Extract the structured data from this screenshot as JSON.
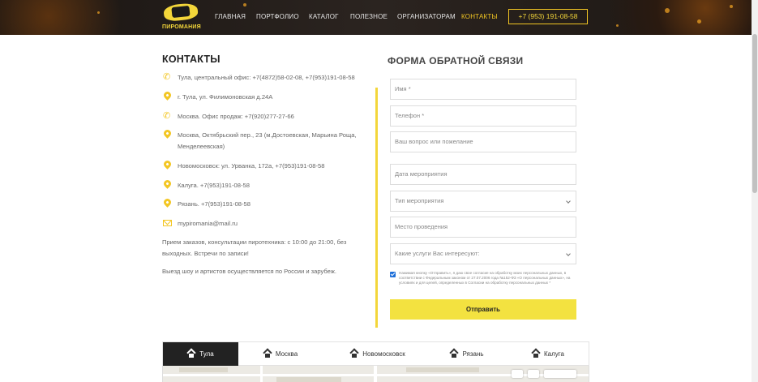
{
  "header": {
    "logo_text": "ПИРОМАНИЯ",
    "nav": [
      {
        "label": "ГЛАВНАЯ",
        "active": false
      },
      {
        "label": "ПОРТФОЛИО",
        "active": false
      },
      {
        "label": "КАТАЛОГ",
        "active": false
      },
      {
        "label": "ПОЛЕЗНОЕ",
        "active": false
      },
      {
        "label": "ОРГАНИЗАТОРАМ",
        "active": false
      },
      {
        "label": "КОНТАКТЫ",
        "active": true
      }
    ],
    "phone": "+7 (953) 191-08-58"
  },
  "contacts": {
    "title": "КОНТАКТЫ",
    "items": [
      {
        "icon": "phone-icon",
        "text": "Тула, центральный офис: +7(4872)58-02-08, +7(953)191-08-58"
      },
      {
        "icon": "map-pin-icon",
        "text": "г. Тула, ул. Филимоновская д.24А"
      },
      {
        "icon": "phone-icon",
        "text": "Москва. Офис продаж: +7(920)277-27-66"
      },
      {
        "icon": "map-pin-icon",
        "text": "Москва, Октябрьский пер., 23 (м.Достоевская, Марьина Роща, Менделеевская)"
      },
      {
        "icon": "map-pin-icon",
        "text": "Новомосковск: ул. Урванка, 172а, +7(953)191-08-58"
      },
      {
        "icon": "map-pin-icon",
        "text": "Калуга. +7(953)191-08-58"
      },
      {
        "icon": "map-pin-icon",
        "text": "Рязань. +7(953)191-08-58"
      },
      {
        "icon": "mail-icon",
        "text": "mypiromania@mail.ru"
      }
    ],
    "hours": "Прием заказов, консультации пиротехника: с 10:00 до 21:00, без выходных. Встречи по записи!",
    "travel": "Выезд шоу и артистов осуществляется по России и зарубеж."
  },
  "form": {
    "title": "ФОРМА ОБРАТНОЙ СВЯЗИ",
    "name_placeholder": "Имя *",
    "phone_placeholder": "Телефон *",
    "question_placeholder": "Ваш вопрос или пожелание",
    "date_placeholder": "Дата мероприятия",
    "event_type": "Тип мероприятия",
    "place_placeholder": "Место проведения",
    "services": "Какие услуги Вас интересуют:",
    "consent_checked": true,
    "consent_text": "Нажимая кнопку «Отправить», я даю свое согласие на обработку моих персональных данных, в соответствии с Федеральным законом от 27.07.2006 года №152-ФЗ «О персональных данных», на условиях и для целей, определенных в Согласии на обработку персональных данных *",
    "submit_label": "Отправить"
  },
  "map_tabs": [
    {
      "label": "Тула",
      "active": true
    },
    {
      "label": "Москва",
      "active": false
    },
    {
      "label": "Новомосковск",
      "active": false
    },
    {
      "label": "Рязань",
      "active": false
    },
    {
      "label": "Калуга",
      "active": false
    }
  ],
  "colors": {
    "accent": "#f3c623",
    "button": "#f3e240",
    "tab_active": "#222222"
  }
}
